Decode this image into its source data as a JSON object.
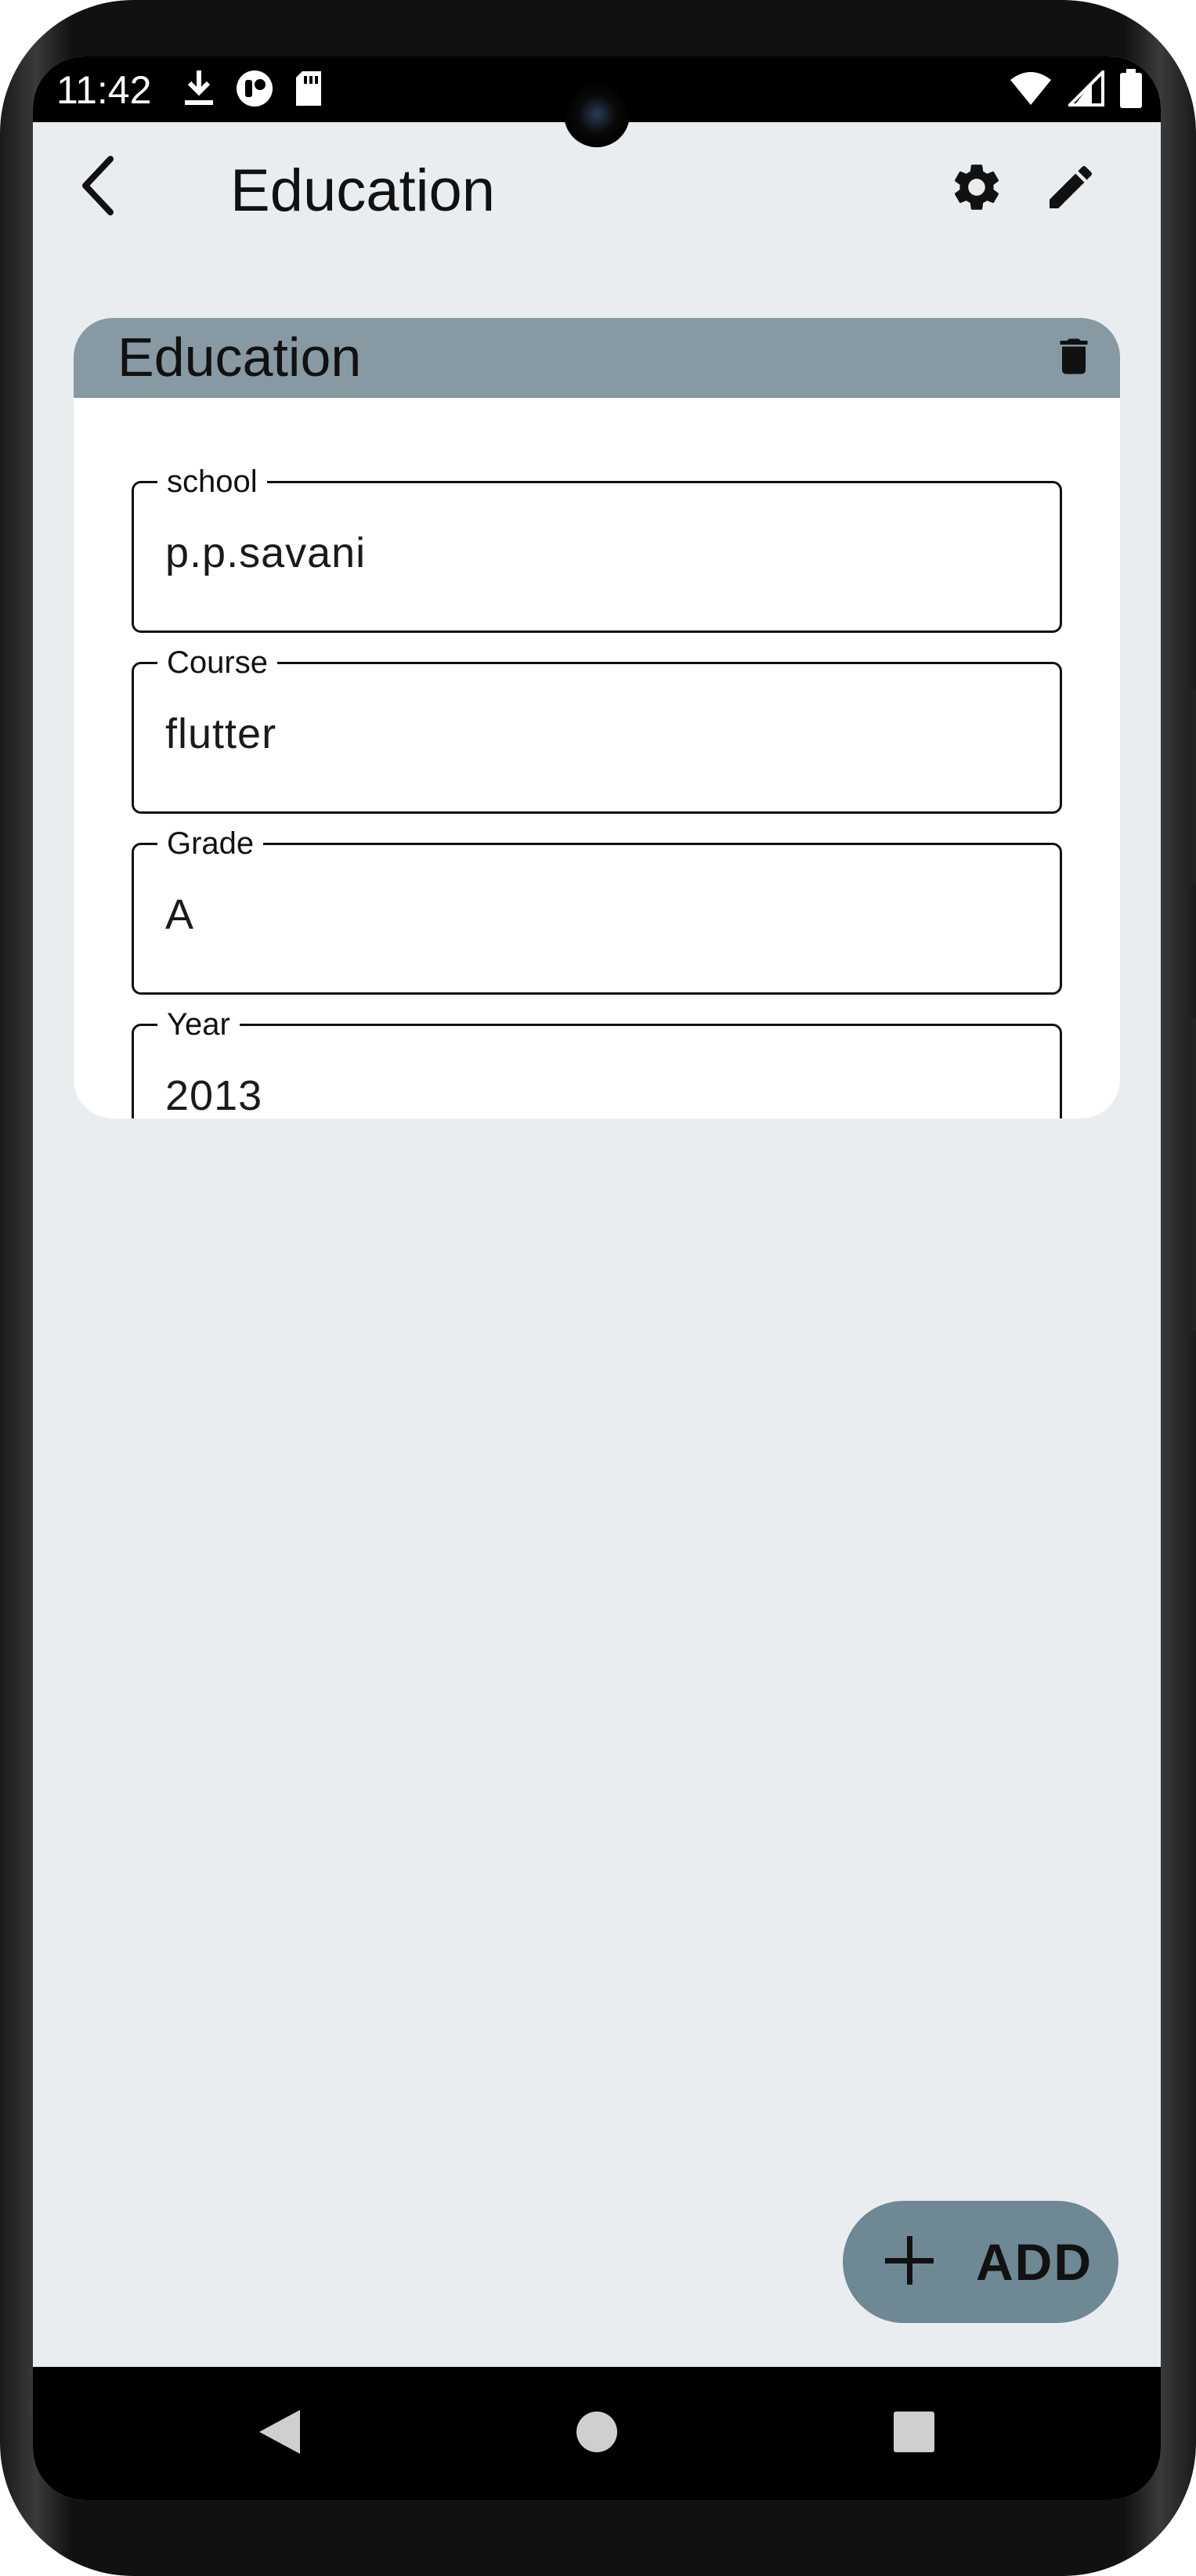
{
  "status_bar": {
    "time": "11:42",
    "icons_left": [
      "download-icon",
      "record-icon",
      "sd-card-icon"
    ],
    "icons_right": [
      "wifi-icon",
      "signal-icon",
      "battery-icon"
    ]
  },
  "app_bar": {
    "title": "Education",
    "back_icon": "chevron-left-icon",
    "settings_icon": "gear-icon",
    "edit_icon": "pencil-icon"
  },
  "card": {
    "title": "Education",
    "delete_icon": "trash-icon",
    "fields": [
      {
        "label": "school",
        "value": "p.p.savani"
      },
      {
        "label": "Course",
        "value": "flutter"
      },
      {
        "label": "Grade",
        "value": "A"
      },
      {
        "label": "Year",
        "value": "2013"
      }
    ]
  },
  "fab": {
    "icon": "plus-icon",
    "label": "ADD"
  },
  "nav_bar": {
    "back_icon": "triangle-back-icon",
    "home_icon": "circle-home-icon",
    "recents_icon": "square-recents-icon"
  },
  "colors": {
    "background": "#e9edf0",
    "card_header": "#8799a2",
    "fab": "#6e8894"
  }
}
